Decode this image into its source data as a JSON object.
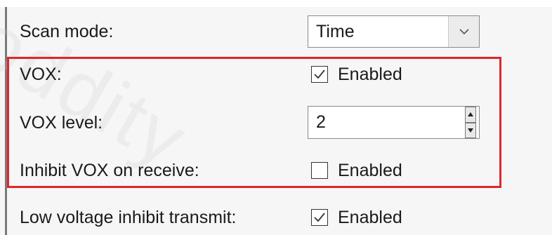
{
  "watermark": "oddity",
  "settings": {
    "scan_mode": {
      "label": "Scan mode:",
      "value": "Time"
    },
    "vox": {
      "label": "VOX:",
      "checkbox_label": "Enabled",
      "checked": true
    },
    "vox_level": {
      "label": "VOX level:",
      "value": "2"
    },
    "inhibit_vox": {
      "label": "Inhibit VOX on receive:",
      "checkbox_label": "Enabled",
      "checked": false
    },
    "low_voltage": {
      "label": "Low voltage inhibit transmit:",
      "checkbox_label": "Enabled",
      "checked": true
    }
  },
  "icons": {
    "combo_arrow": "chevron-down-icon",
    "check": "checkmark-icon",
    "spin_up": "triangle-up-icon",
    "spin_down": "triangle-down-icon"
  },
  "colors": {
    "highlight": "#e0262a",
    "background": "#f6f6f6"
  }
}
